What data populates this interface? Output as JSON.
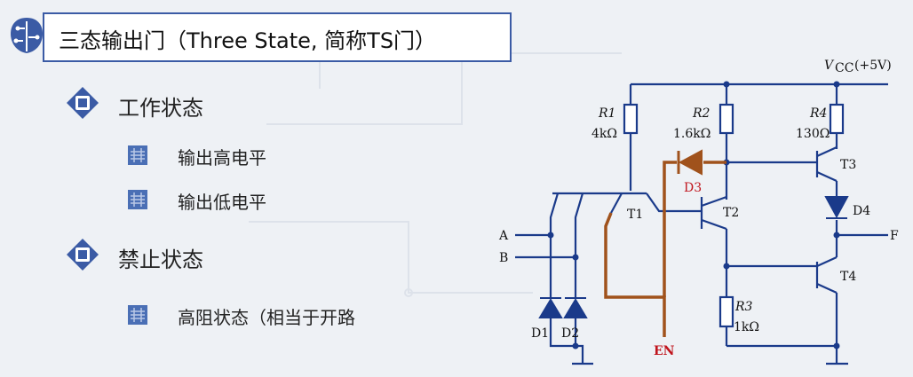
{
  "slide": {
    "title": "三态输出门（Three State, 简称TS门）",
    "sections": [
      {
        "heading": "工作状态",
        "items": [
          "输出高电平",
          "输出低电平"
        ]
      },
      {
        "heading": "禁止状态",
        "items": [
          "高阻状态（相当于开路"
        ]
      }
    ]
  },
  "circuit": {
    "vcc": "V",
    "vcc_sub": "CC",
    "vcc_value": "(+5V)",
    "r1_name": "R1",
    "r1_value": "4kΩ",
    "r2_name": "R2",
    "r2_value": "1.6kΩ",
    "r3_name": "R3",
    "r3_value": "1kΩ",
    "r4_name": "R4",
    "r4_value": "130Ω",
    "t1": "T1",
    "t2": "T2",
    "t3": "T3",
    "t4": "T4",
    "d1": "D1",
    "d2": "D2",
    "d3": "D3",
    "d4": "D4",
    "in_a": "A",
    "in_b": "B",
    "out_f": "F",
    "en": "EN"
  },
  "colors": {
    "accent": "#3b5ba5",
    "enable_path": "#a0521c",
    "label_red": "#c0141c"
  }
}
